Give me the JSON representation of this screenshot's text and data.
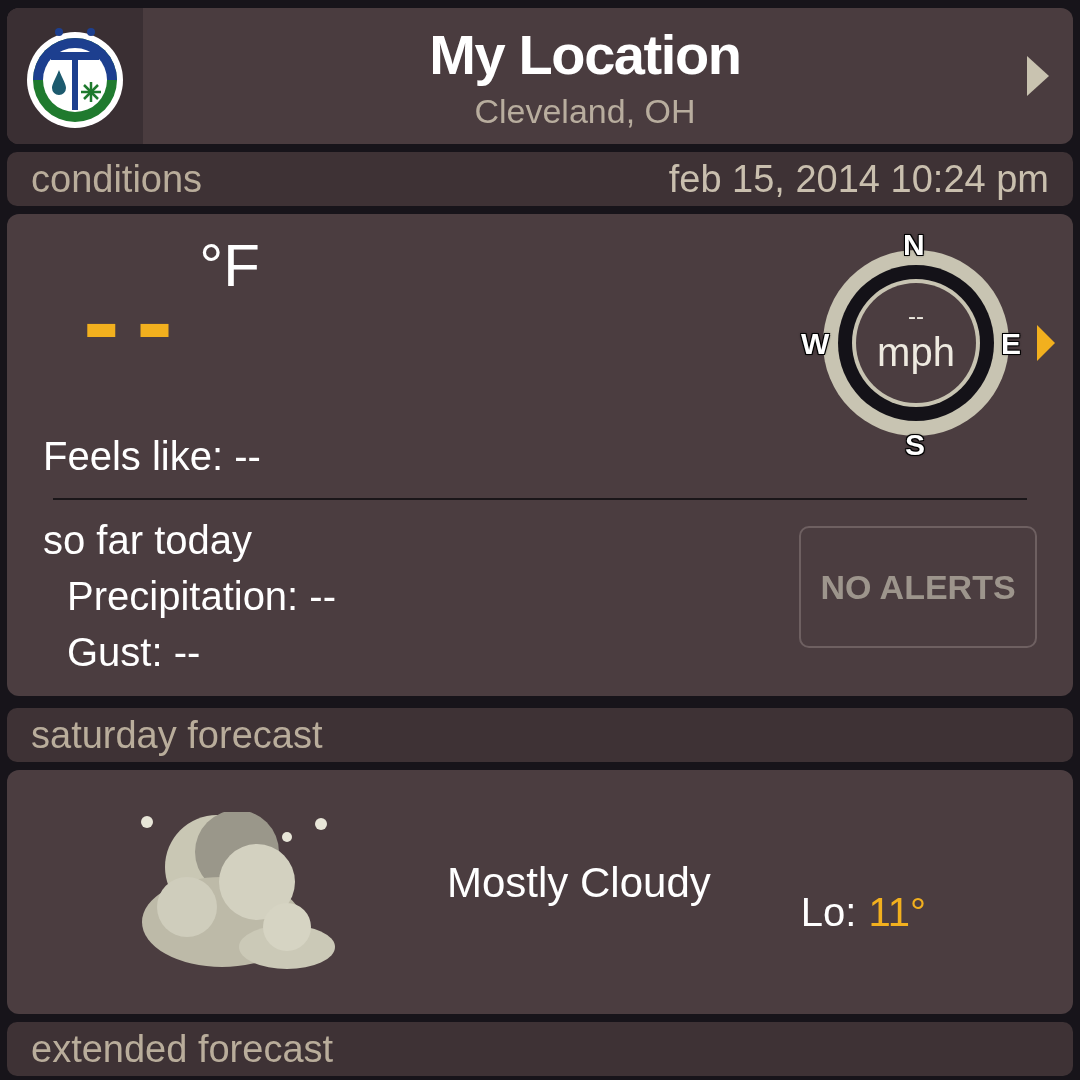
{
  "header": {
    "title": "My Location",
    "subtitle": "Cleveland, OH"
  },
  "conditions": {
    "label": "conditions",
    "timestamp": "feb 15, 2014 10:24 pm",
    "temperature": "--",
    "unit": "°F",
    "feels_like": "Feels like: --",
    "wind": {
      "speed": "--",
      "unit": "mph",
      "north": "N",
      "east": "E",
      "south": "S",
      "west": "W"
    },
    "so_far_today": {
      "title": "so far today",
      "lines": [
        "Precipitation: --",
        "Gust: --"
      ]
    },
    "alerts_button": "NO ALERTS"
  },
  "forecast": {
    "label": "saturday forecast",
    "summary": "Mostly Cloudy",
    "low_label": "Lo:",
    "low_value": "11°"
  },
  "extended": {
    "label": "extended forecast"
  }
}
